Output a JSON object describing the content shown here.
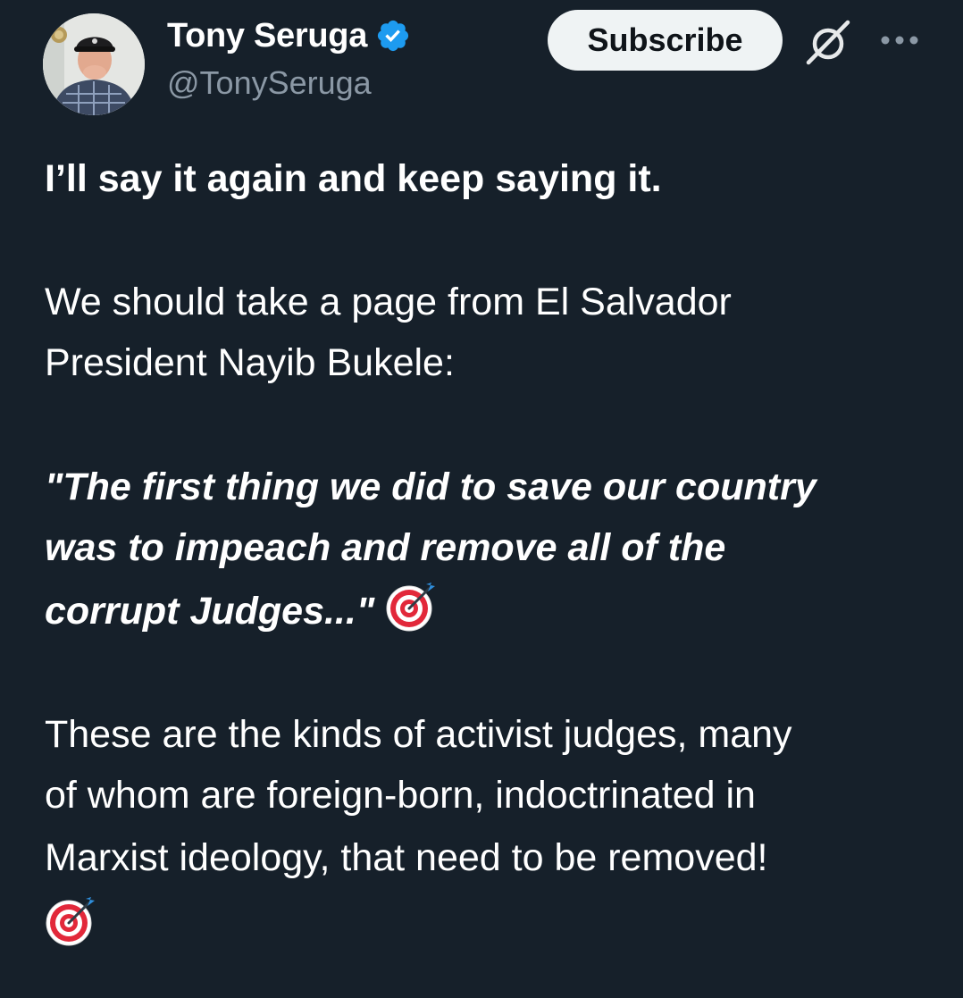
{
  "author": {
    "display_name": "Tony Seruga",
    "handle": "@TonySeruga",
    "verified": true
  },
  "actions": {
    "subscribe_label": "Subscribe"
  },
  "icons": {
    "verified": "verified-badge-icon",
    "grok": "grok-icon",
    "more": "more-options-icon",
    "emoji": "direct-hit-target-emoji"
  },
  "post": {
    "line1": "I’ll say it again and keep saying it.",
    "line2": "We should take a page from El Salvador",
    "line3": "President Nayib Bukele:",
    "quote1": "\"The first thing we did to save our country",
    "quote2": "was to impeach and remove all of the",
    "quote3": "corrupt Judges...\"",
    "para1": "These are the kinds of activist judges, many",
    "para2": "of whom are foreign-born, indoctrinated in",
    "para3": "Marxist ideology,  that need to be removed!"
  },
  "colors": {
    "background": "#16202a",
    "verified_blue": "#1d9bf0",
    "secondary_text": "#8b98a5",
    "subscribe_bg": "#eff3f4"
  }
}
